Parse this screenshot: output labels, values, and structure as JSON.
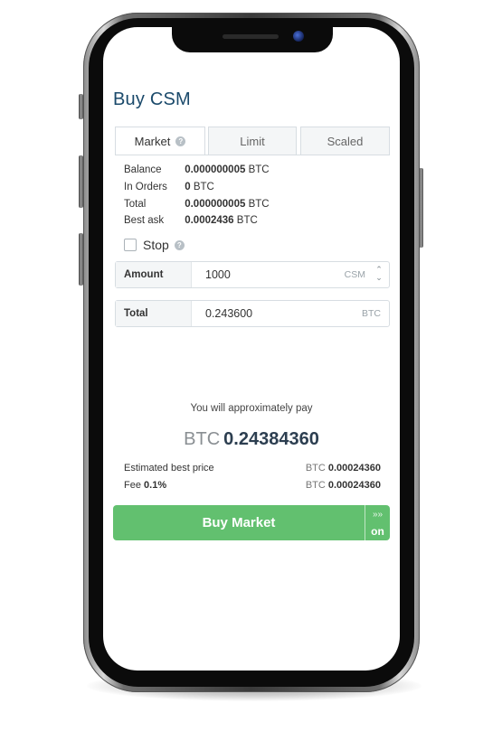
{
  "page": {
    "title": "Buy CSM"
  },
  "tabs": [
    {
      "label": "Market",
      "active": true,
      "help": "?"
    },
    {
      "label": "Limit",
      "active": false
    },
    {
      "label": "Scaled",
      "active": false
    }
  ],
  "info": {
    "balance": {
      "label": "Balance",
      "value": "0.000000005",
      "unit": "BTC"
    },
    "in_orders": {
      "label": "In Orders",
      "value": "0",
      "unit": "BTC"
    },
    "total": {
      "label": "Total",
      "value": "0.000000005",
      "unit": "BTC"
    },
    "best_ask": {
      "label": "Best ask",
      "value": "0.0002436",
      "unit": "BTC"
    }
  },
  "stop": {
    "label": "Stop",
    "checked": false,
    "help": "?"
  },
  "amount_field": {
    "label": "Amount",
    "value": "1000",
    "currency": "CSM"
  },
  "total_field": {
    "label": "Total",
    "value": "0.243600",
    "currency": "BTC"
  },
  "summary": {
    "approx_text": "You will approximately pay",
    "currency": "BTC",
    "amount": "0.24384360",
    "estimated_best_price": {
      "label": "Estimated best price",
      "currency": "BTC",
      "value": "0.00024360"
    },
    "fee": {
      "label": "Fee",
      "percent": "0.1%",
      "currency": "BTC",
      "value": "0.00024360"
    }
  },
  "buy_button": {
    "label": "Buy Market",
    "toggle_label": "on",
    "toggle_icon": "double-chevron-right-icon"
  },
  "colors": {
    "accent_green": "#62c06f",
    "title_blue": "#1b4a6b"
  }
}
